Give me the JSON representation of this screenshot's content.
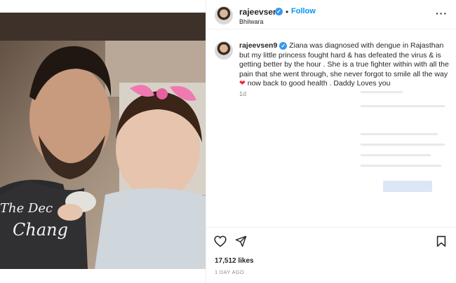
{
  "post": {
    "username": "rajeevsen9",
    "follow_label": "Follow",
    "location": "Bhilwara",
    "dot": "•",
    "more_label": "···",
    "verified_glyph": "✓",
    "caption_text": "Ziana was diagnosed with dengue in Rajasthan but my little princess fought hard & has defeated the virus & is getting better by the hour . She is a true fighter within with all the pain that she went through, she never forgot to smile all the way",
    "caption_heart": "❤",
    "caption_tail": " now back to good health . Daddy Loves you",
    "caption_time": "1d",
    "likes": "17,512 likes",
    "time_ago": "1 DAY AGO"
  },
  "photo": {
    "tshirt_text_1": "The Dec",
    "tshirt_text_2": "Chang"
  },
  "icons": {
    "heart": "heart-icon",
    "share": "share-icon",
    "save": "bookmark-icon",
    "more": "more-icon",
    "verified": "verified-badge-icon"
  },
  "colors": {
    "link_blue": "#0095f6",
    "verified_blue": "#3897f0",
    "heart_red": "#ed2a3d",
    "bow_pink": "#f07ab0"
  }
}
